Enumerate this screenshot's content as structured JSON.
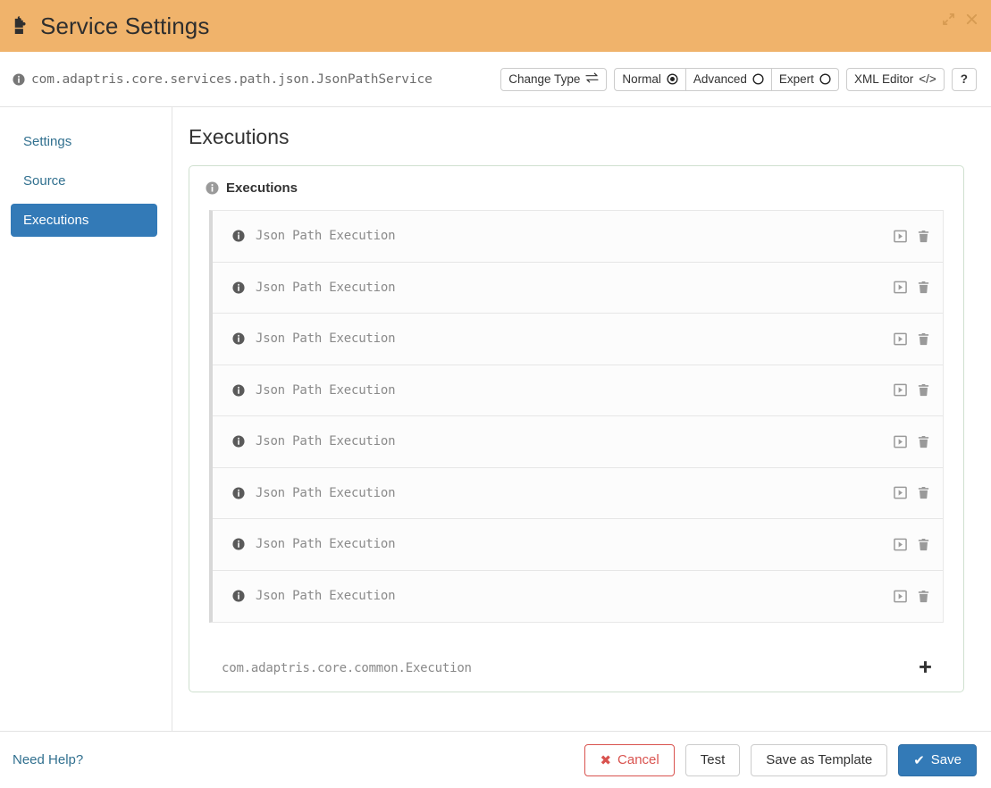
{
  "window": {
    "title": "Service Settings",
    "icon": "puzzle-piece-icon",
    "controls": [
      {
        "name": "expand-icon",
        "glyph": "↗"
      },
      {
        "name": "close-icon",
        "glyph": "✕"
      }
    ],
    "header_color": "#f0b36b"
  },
  "toolbar": {
    "class_path": "com.adaptris.core.services.path.json.JsonPathService",
    "change_type_label": "Change Type",
    "modes": [
      {
        "label": "Normal",
        "selected": true
      },
      {
        "label": "Advanced",
        "selected": false
      },
      {
        "label": "Expert",
        "selected": false
      }
    ],
    "xml_editor_label": "XML Editor",
    "xml_editor_glyph": "</>",
    "help_label": "?"
  },
  "sidebar": {
    "items": [
      {
        "label": "Settings",
        "active": false
      },
      {
        "label": "Source",
        "active": false
      },
      {
        "label": "Executions",
        "active": true
      }
    ],
    "active_color": "#337ab7",
    "link_color": "#31708f"
  },
  "main": {
    "page_title": "Executions",
    "panel": {
      "heading": "Executions",
      "rows": [
        {
          "label": "Json Path Execution"
        },
        {
          "label": "Json Path Execution"
        },
        {
          "label": "Json Path Execution"
        },
        {
          "label": "Json Path Execution"
        },
        {
          "label": "Json Path Execution"
        },
        {
          "label": "Json Path Execution"
        },
        {
          "label": "Json Path Execution"
        },
        {
          "label": "Json Path Execution"
        }
      ],
      "row_actions": [
        {
          "name": "open-icon"
        },
        {
          "name": "delete-icon"
        }
      ],
      "add_class": "com.adaptris.core.common.Execution",
      "add_glyph": "+"
    }
  },
  "footer": {
    "need_help": "Need Help?",
    "buttons": [
      {
        "label": "Cancel",
        "style": "cancel",
        "glyph": "✖"
      },
      {
        "label": "Test",
        "style": "default",
        "glyph": ""
      },
      {
        "label": "Save as Template",
        "style": "default",
        "glyph": ""
      },
      {
        "label": "Save",
        "style": "save",
        "glyph": "✔"
      }
    ]
  }
}
